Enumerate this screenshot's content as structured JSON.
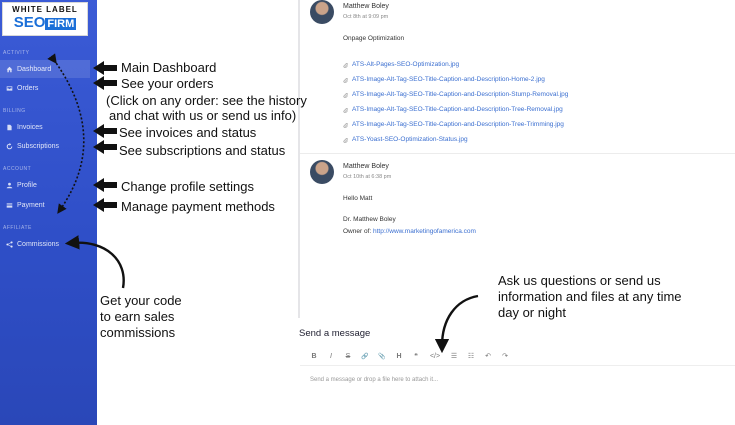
{
  "logo": {
    "top": "WHITE LABEL",
    "bottom_left": "SEO",
    "bottom_right": "FIRM"
  },
  "sidebar": {
    "sections": [
      {
        "head": "ACTIVITY"
      },
      {
        "head": "BILLING"
      },
      {
        "head": "ACCOUNT"
      },
      {
        "head": "AFFILIATE"
      }
    ],
    "items": [
      {
        "label": "Dashboard"
      },
      {
        "label": "Orders"
      },
      {
        "label": "Invoices"
      },
      {
        "label": "Subscriptions"
      },
      {
        "label": "Profile"
      },
      {
        "label": "Payment"
      },
      {
        "label": "Commissions"
      }
    ]
  },
  "messages": [
    {
      "author": "Matthew Boley",
      "time": "Oct 8th at 9:09 pm",
      "text": "Onpage Optimization",
      "files": [
        "ATS-Alt-Pages-SEO-Optimization.jpg",
        "ATS-Image-Alt-Tag-SEO-Title-Caption-and-Description-Home-2.jpg",
        "ATS-Image-Alt-Tag-SEO-Title-Caption-and-Description-Stump-Removal.jpg",
        "ATS-Image-Alt-Tag-SEO-Title-Caption-and-Description-Tree-Removal.jpg",
        "ATS-Image-Alt-Tag-SEO-Title-Caption-and-Description-Tree-Trimming.jpg",
        "ATS-Yoast-SEO-Optimization-Status.jpg"
      ]
    },
    {
      "author": "Matthew Boley",
      "time": "Oct 10th at 6:38 pm",
      "line1": "Hello Matt",
      "line2": "Dr. Matthew Boley",
      "line3_prefix": "Owner of: ",
      "line3_link": "http://www.marketingofamerica.com"
    }
  ],
  "composer": {
    "title": "Send a message",
    "placeholder": "Send a message or drop a file here to attach it...",
    "tools": [
      "B",
      "I",
      "S",
      "🔗",
      "📎",
      "H",
      "❝",
      "</>",
      "☰",
      "☷",
      "↶",
      "↷"
    ]
  },
  "annotations": {
    "main_dashboard": "Main Dashboard",
    "orders": "See your orders",
    "orders_note1": "(Click on any order: see the history",
    "orders_note2": "and chat with us or send us info)",
    "invoices": "See invoices and status",
    "subscriptions": "See subscriptions and status",
    "profile": "Change profile settings",
    "payment": "Manage payment methods",
    "commissions1": "Get your code",
    "commissions2": "to earn sales",
    "commissions3": "commissions",
    "questions1": "Ask us questions or send us",
    "questions2": "information and files at any time",
    "questions3": "day or night"
  }
}
